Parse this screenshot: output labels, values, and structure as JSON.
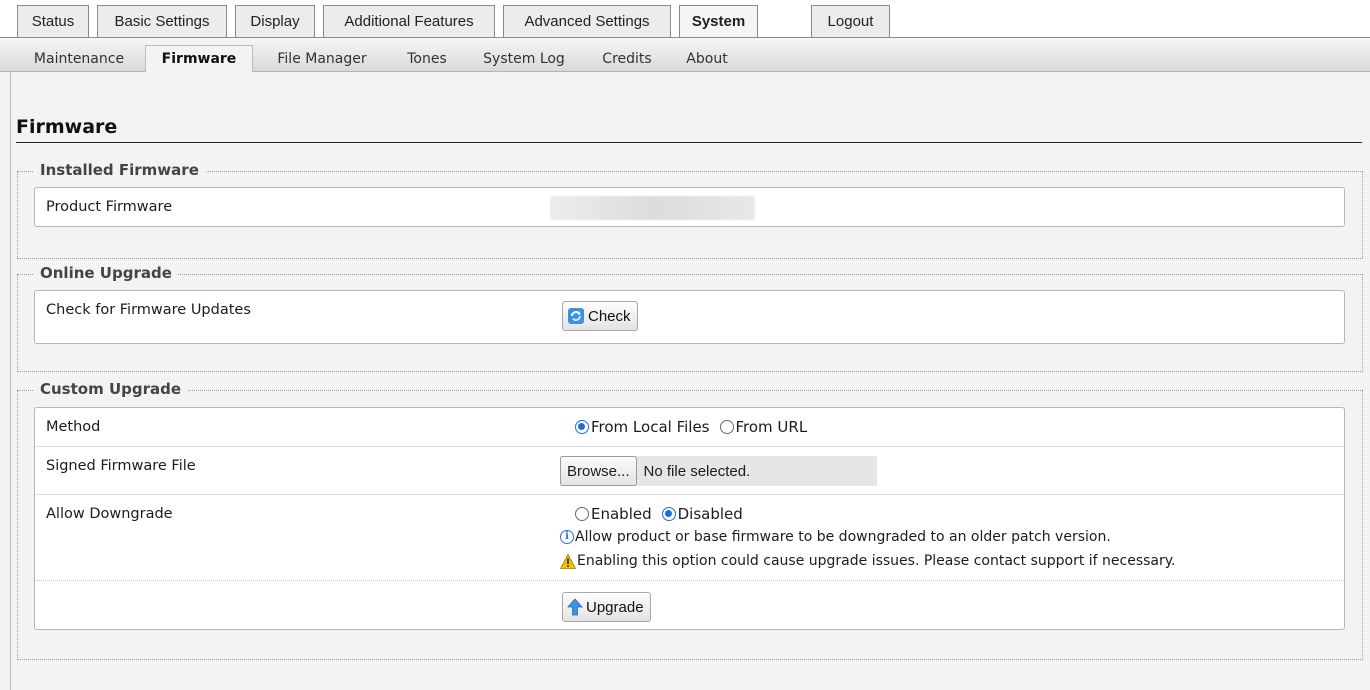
{
  "top_tabs": [
    {
      "label": "Status",
      "active": false
    },
    {
      "label": "Basic Settings",
      "active": false
    },
    {
      "label": "Display",
      "active": false
    },
    {
      "label": "Additional Features",
      "active": false
    },
    {
      "label": "Advanced Settings",
      "active": false
    },
    {
      "label": "System",
      "active": true
    },
    {
      "label": "Logout",
      "active": false
    }
  ],
  "sub_tabs": [
    {
      "label": "Maintenance",
      "active": false
    },
    {
      "label": "Firmware",
      "active": true
    },
    {
      "label": "File Manager",
      "active": false
    },
    {
      "label": "Tones",
      "active": false
    },
    {
      "label": "System Log",
      "active": false
    },
    {
      "label": "Credits",
      "active": false
    },
    {
      "label": "About",
      "active": false
    }
  ],
  "page_title": "Firmware",
  "installed": {
    "legend": "Installed Firmware",
    "product_firmware_label": "Product Firmware"
  },
  "online": {
    "legend": "Online Upgrade",
    "check_label": "Check for Firmware Updates",
    "check_button": "Check"
  },
  "custom": {
    "legend": "Custom Upgrade",
    "method_label": "Method",
    "method_options": [
      "From Local Files",
      "From URL"
    ],
    "method_selected": "From Local Files",
    "file_label": "Signed Firmware File",
    "browse_button": "Browse...",
    "file_status": "No file selected.",
    "downgrade_label": "Allow Downgrade",
    "downgrade_options": [
      "Enabled",
      "Disabled"
    ],
    "downgrade_selected": "Disabled",
    "info_note": "Allow product or base firmware to be downgraded to an older patch version.",
    "warning_note": "Enabling this option could cause upgrade issues. Please contact support if necessary.",
    "upgrade_button": "Upgrade"
  },
  "colors": {
    "accent": "#1a6fd6",
    "warning": "#f2c200"
  }
}
